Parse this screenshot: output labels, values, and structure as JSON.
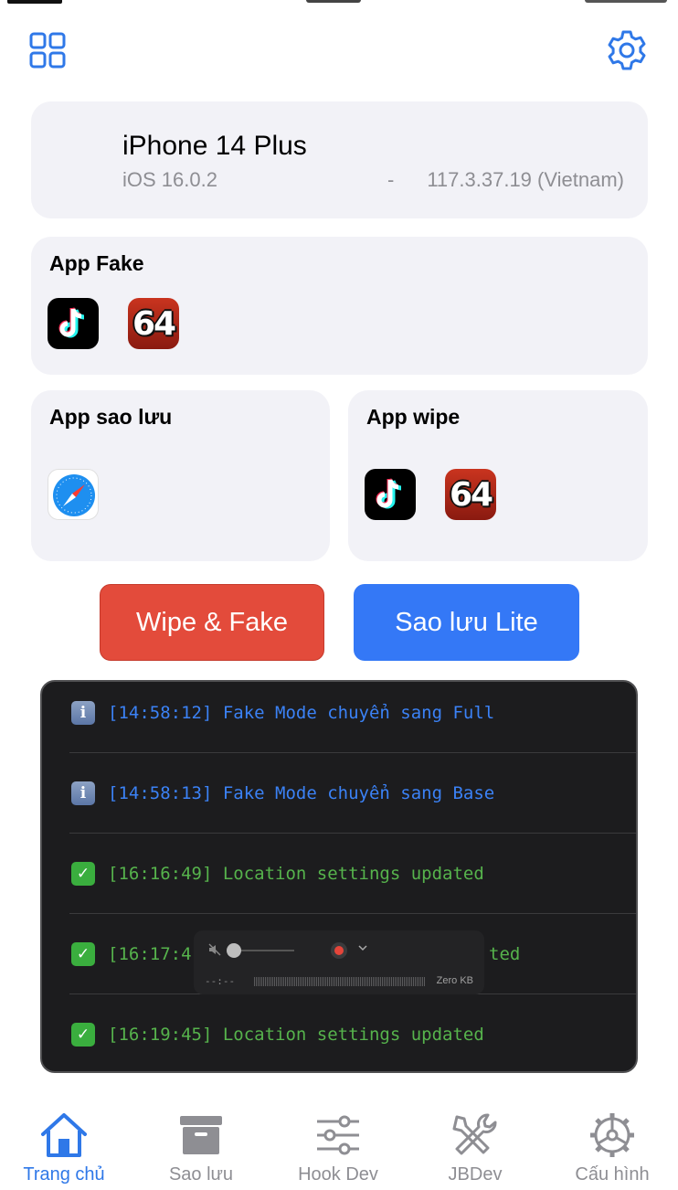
{
  "header": {
    "left_icon": "grid-icon",
    "right_icon": "gear-icon"
  },
  "device": {
    "name": "iPhone 14 Plus",
    "os": "iOS 16.0.2",
    "dash": "-",
    "ip": "117.3.37.19 (Vietnam)"
  },
  "app_fake": {
    "title": "App Fake",
    "apps": [
      "tiktok-icon",
      "n64-icon"
    ],
    "n64_text": "64"
  },
  "app_backup": {
    "title": "App sao lưu",
    "apps": [
      "safari-icon"
    ]
  },
  "app_wipe": {
    "title": "App wipe",
    "apps": [
      "tiktok-icon",
      "n64-icon"
    ],
    "n64_text": "64"
  },
  "actions": {
    "wipe_fake": "Wipe & Fake",
    "backup_lite": "Sao lưu Lite"
  },
  "console": {
    "lines": [
      {
        "icon": "ℹ",
        "type": "info",
        "text": "[14:58:12] Fake Mode chuyển sang Full"
      },
      {
        "icon": "✓",
        "type": "ok",
        "text": "[14:58:13] Fake Mode chuyển sang Base"
      },
      {
        "icon": "✓",
        "type": "ok",
        "text": "[16:16:49] Location settings updated"
      },
      {
        "icon": "✓",
        "type": "ok",
        "text": "[16:17:4"
      },
      {
        "icon": "✓",
        "type": "ok",
        "text": "[16:19:45] Location settings updated"
      }
    ],
    "line4_tail": "ted"
  },
  "recorder": {
    "time": "--:--",
    "size": "Zero KB"
  },
  "tabs": [
    {
      "label": "Trang chủ",
      "icon": "home-icon",
      "active": true
    },
    {
      "label": "Sao lưu",
      "icon": "archive-icon",
      "active": false
    },
    {
      "label": "Hook Dev",
      "icon": "sliders-icon",
      "active": false
    },
    {
      "label": "JBDev",
      "icon": "tools-icon",
      "active": false
    },
    {
      "label": "Cấu hình",
      "icon": "settings-icon",
      "active": false
    }
  ],
  "colors": {
    "accent": "#3478f6",
    "danger": "#e34b3b",
    "info_text": "#3b82f6",
    "ok_text": "#56b34c",
    "card_bg": "#f2f2f7"
  }
}
